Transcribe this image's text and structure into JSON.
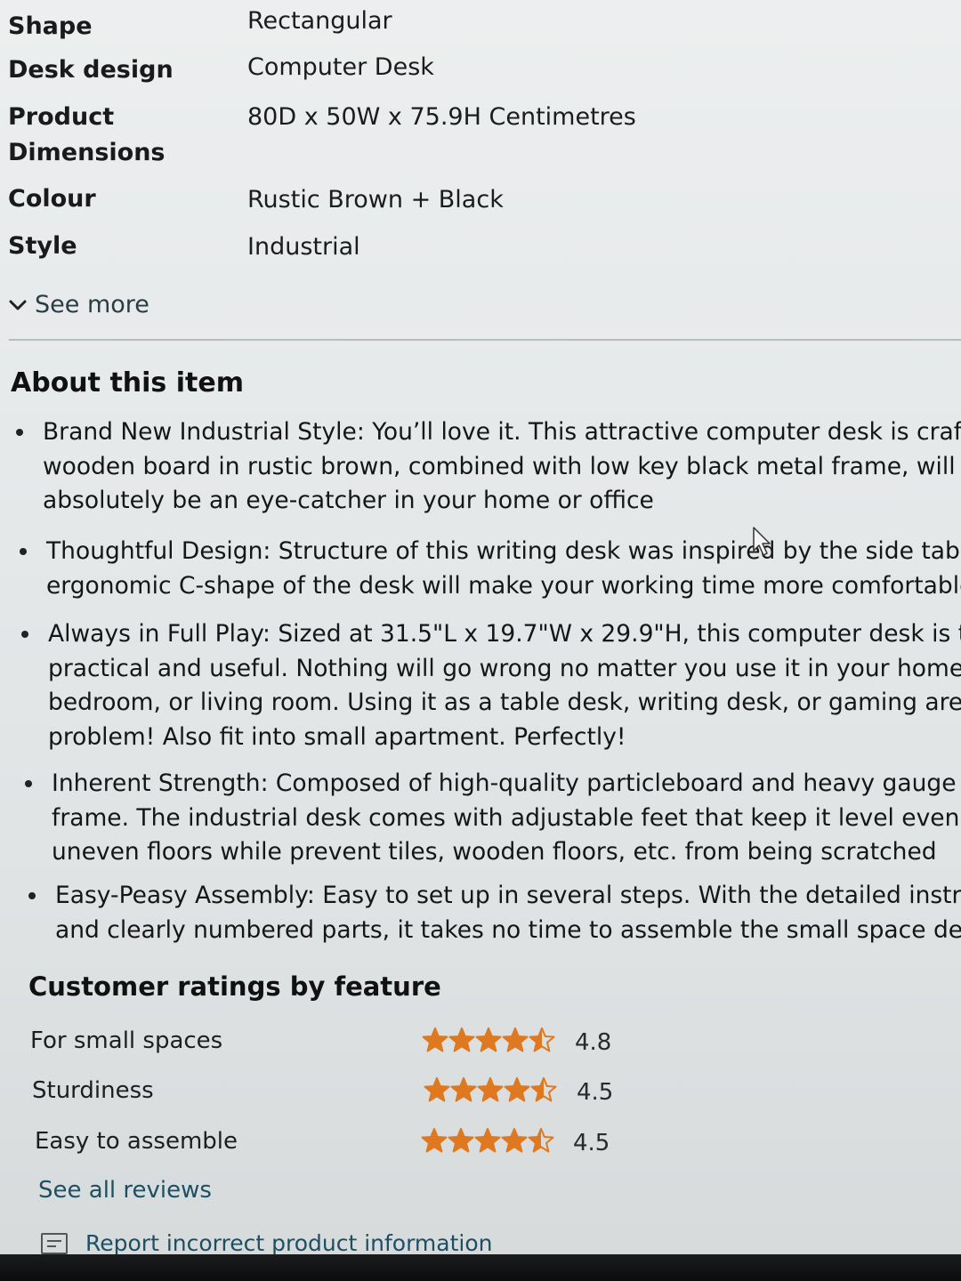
{
  "specs": [
    {
      "label": "Shape",
      "value": "Rectangular"
    },
    {
      "label": "Desk design",
      "value": "Computer Desk"
    },
    {
      "label": "Product Dimensions",
      "label_lines": [
        "Product",
        "Dimensions"
      ],
      "value": "80D x 50W x 75.9H Centimetres"
    },
    {
      "label": "Colour",
      "value": "Rustic Brown + Black"
    },
    {
      "label": "Style",
      "value": "Industrial"
    }
  ],
  "see_more": {
    "label": "See more",
    "icon": "chevron-down-icon"
  },
  "about": {
    "title": "About this item",
    "bullets": [
      {
        "lines": [
          "Brand New Industrial Style: You’ll love it. This attractive computer desk is crafted w",
          "wooden board in rustic brown, combined with low key black metal frame, will",
          "absolutely be an eye-catcher in your home or office"
        ]
      },
      {
        "lines": [
          "Thoughtful Design: Structure of this writing desk was inspired by the side table. The",
          "ergonomic C-shape of the desk will make your working time more comfortable"
        ]
      },
      {
        "lines": [
          "Always in Full Play: Sized at 31.5\"L x 19.7\"W x 29.9\"H, this computer desk is truly",
          "practical and useful. Nothing will go wrong no matter you use it in your home study,",
          "bedroom, or living room. Using it as a table desk, writing desk, or gaming area are no",
          "problem! Also fit into small apartment. Perfectly!"
        ]
      },
      {
        "lines": [
          "Inherent Strength: Composed of high-quality particleboard and heavy gauge metal",
          "frame. The industrial desk comes with adjustable feet that keep it level even on",
          "uneven floors while prevent tiles, wooden floors, etc. from being scratched"
        ]
      },
      {
        "lines": [
          "Easy-Peasy Assembly: Easy to set up in several steps. With the detailed instructions",
          "and clearly numbered parts, it takes no time to assemble the small space desk"
        ]
      }
    ]
  },
  "ratings": {
    "title": "Customer ratings by feature",
    "star_color": "#de7921",
    "items": [
      {
        "label": "For small spaces",
        "value": "4.8",
        "stars": 4.8
      },
      {
        "label": "Sturdiness",
        "value": "4.5",
        "stars": 4.5
      },
      {
        "label": "Easy to assemble",
        "value": "4.5",
        "stars": 4.5
      }
    ],
    "see_all": "See all reviews"
  },
  "report": {
    "label": "Report incorrect product information",
    "icon": "report-icon"
  }
}
